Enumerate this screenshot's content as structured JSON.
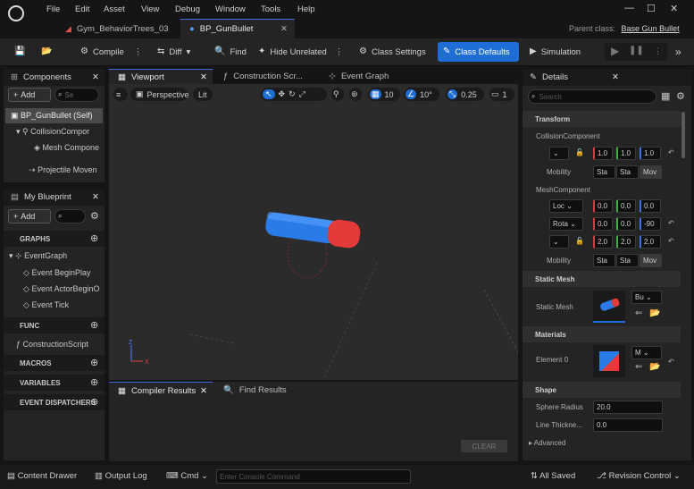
{
  "menu": [
    "File",
    "Edit",
    "Asset",
    "View",
    "Debug",
    "Window",
    "Tools",
    "Help"
  ],
  "tabs": [
    {
      "label": "Gym_BehaviorTrees_03"
    },
    {
      "label": "BP_GunBullet"
    }
  ],
  "parent_class": {
    "label": "Parent class:",
    "value": "Base Gun Bullet"
  },
  "toolbar": {
    "compile": "Compile",
    "diff": "Diff",
    "find": "Find",
    "hide_unrelated": "Hide Unrelated",
    "class_settings": "Class Settings",
    "class_defaults": "Class Defaults",
    "simulation": "Simulation"
  },
  "components": {
    "title": "Components",
    "add": "Add",
    "search_placeholder": "Se",
    "items": [
      "BP_GunBullet (Self)",
      "CollisionCompor",
      "Mesh Compone",
      "Projectile Moven"
    ]
  },
  "my_blueprint": {
    "title": "My Blueprint",
    "add": "Add",
    "sections": {
      "graphs": "GRAPHS",
      "func": "FUNC",
      "macros": "MACROS",
      "variables": "VARIABLES",
      "dispatchers": "EVENT DISPATCHERS"
    },
    "graphs": [
      "EventGraph",
      "Event BeginPlay",
      "Event ActorBeginO",
      "Event Tick"
    ],
    "functions": [
      "ConstructionScript"
    ]
  },
  "center_tabs": [
    "Viewport",
    "Construction Scr...",
    "Event Graph"
  ],
  "viewport": {
    "perspective": "Perspective",
    "lit": "Lit",
    "grid": "10",
    "angle": "10°",
    "scale": "0.25",
    "cam": "1"
  },
  "bottom_tabs": {
    "compiler": "Compiler Results",
    "find": "Find Results",
    "clear": "CLEAR"
  },
  "details": {
    "title": "Details",
    "search_placeholder": "Search",
    "transform": "Transform",
    "collision": "CollisionComponent",
    "collision_scale": [
      "1.0",
      "1.0",
      "1.0"
    ],
    "mobility": "Mobility",
    "mobility_opts": [
      "Sta",
      "Sta",
      "Mov"
    ],
    "mesh": "MeshComponent",
    "loc_label": "Loc",
    "loc": [
      "0.0",
      "0.0",
      "0.0"
    ],
    "rot_label": "Rota",
    "rot": [
      "0.0",
      "0.0",
      "-90"
    ],
    "mesh_scale": [
      "2.0",
      "2.0",
      "2.0"
    ],
    "static_mesh_header": "Static Mesh",
    "static_mesh_label": "Static Mesh",
    "static_mesh_value": "Bu",
    "materials": "Materials",
    "element0": "Element 0",
    "element0_value": "M",
    "shape": "Shape",
    "sphere_radius": "Sphere Radius",
    "sphere_radius_value": "20.0",
    "line_thickness": "Line Thickne...",
    "line_thickness_value": "0.0",
    "advanced": "Advanced"
  },
  "statusbar": {
    "content_drawer": "Content Drawer",
    "output_log": "Output Log",
    "cmd": "Cmd",
    "console_placeholder": "Enter Console Command",
    "all_saved": "All Saved",
    "revision": "Revision Control"
  },
  "colors": {
    "accent": "#1e6ed6",
    "bullet_blue": "#2a7be8",
    "bullet_red": "#e43a3a"
  }
}
